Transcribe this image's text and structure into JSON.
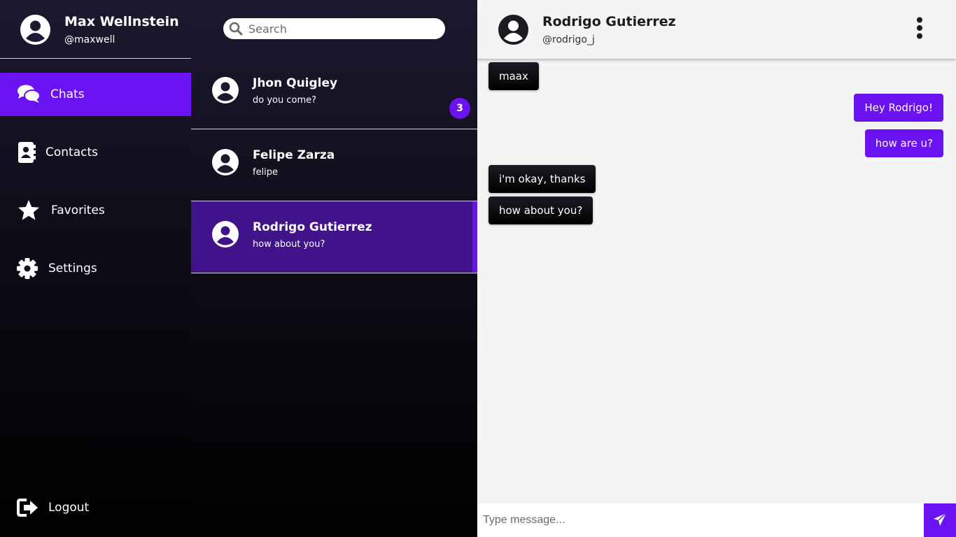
{
  "user": {
    "name": "Max Wellnstein",
    "handle": "@maxwell",
    "avatar_icon": "user-circle-icon"
  },
  "nav": {
    "items": [
      {
        "label": "Chats",
        "icon": "chat-bubbles-icon",
        "active": true
      },
      {
        "label": "Contacts",
        "icon": "address-book-icon",
        "active": false
      },
      {
        "label": "Favorites",
        "icon": "star-icon",
        "active": false
      },
      {
        "label": "Settings",
        "icon": "gear-icon",
        "active": false
      }
    ],
    "logout": {
      "label": "Logout",
      "icon": "logout-icon"
    }
  },
  "search": {
    "placeholder": "Search",
    "value": ""
  },
  "chats": [
    {
      "name": "Jhon Quigley",
      "preview": "do you come?",
      "unread": "3",
      "active": false
    },
    {
      "name": "Felipe Zarza",
      "preview": "felipe",
      "active": false
    },
    {
      "name": "Rodrigo Gutierrez",
      "preview": "how about you?",
      "active": true
    }
  ],
  "conversation": {
    "contact_name": "Rodrigo Gutierrez",
    "contact_handle": "@rodrigo_j",
    "messages": [
      {
        "text": "maax",
        "direction": "in"
      },
      {
        "text": "Hey Rodrigo!",
        "direction": "out"
      },
      {
        "text": "how are u?",
        "direction": "out"
      },
      {
        "text": "i'm okay, thanks",
        "direction": "in"
      },
      {
        "text": "how about you?",
        "direction": "in"
      }
    ],
    "composer": {
      "placeholder": "Type message...",
      "value": ""
    }
  },
  "colors": {
    "accent": "#6a12f2",
    "active_chat_bg": "#40138a",
    "panel_light": "#f4f4f4",
    "incoming_bubble": "#000000"
  }
}
